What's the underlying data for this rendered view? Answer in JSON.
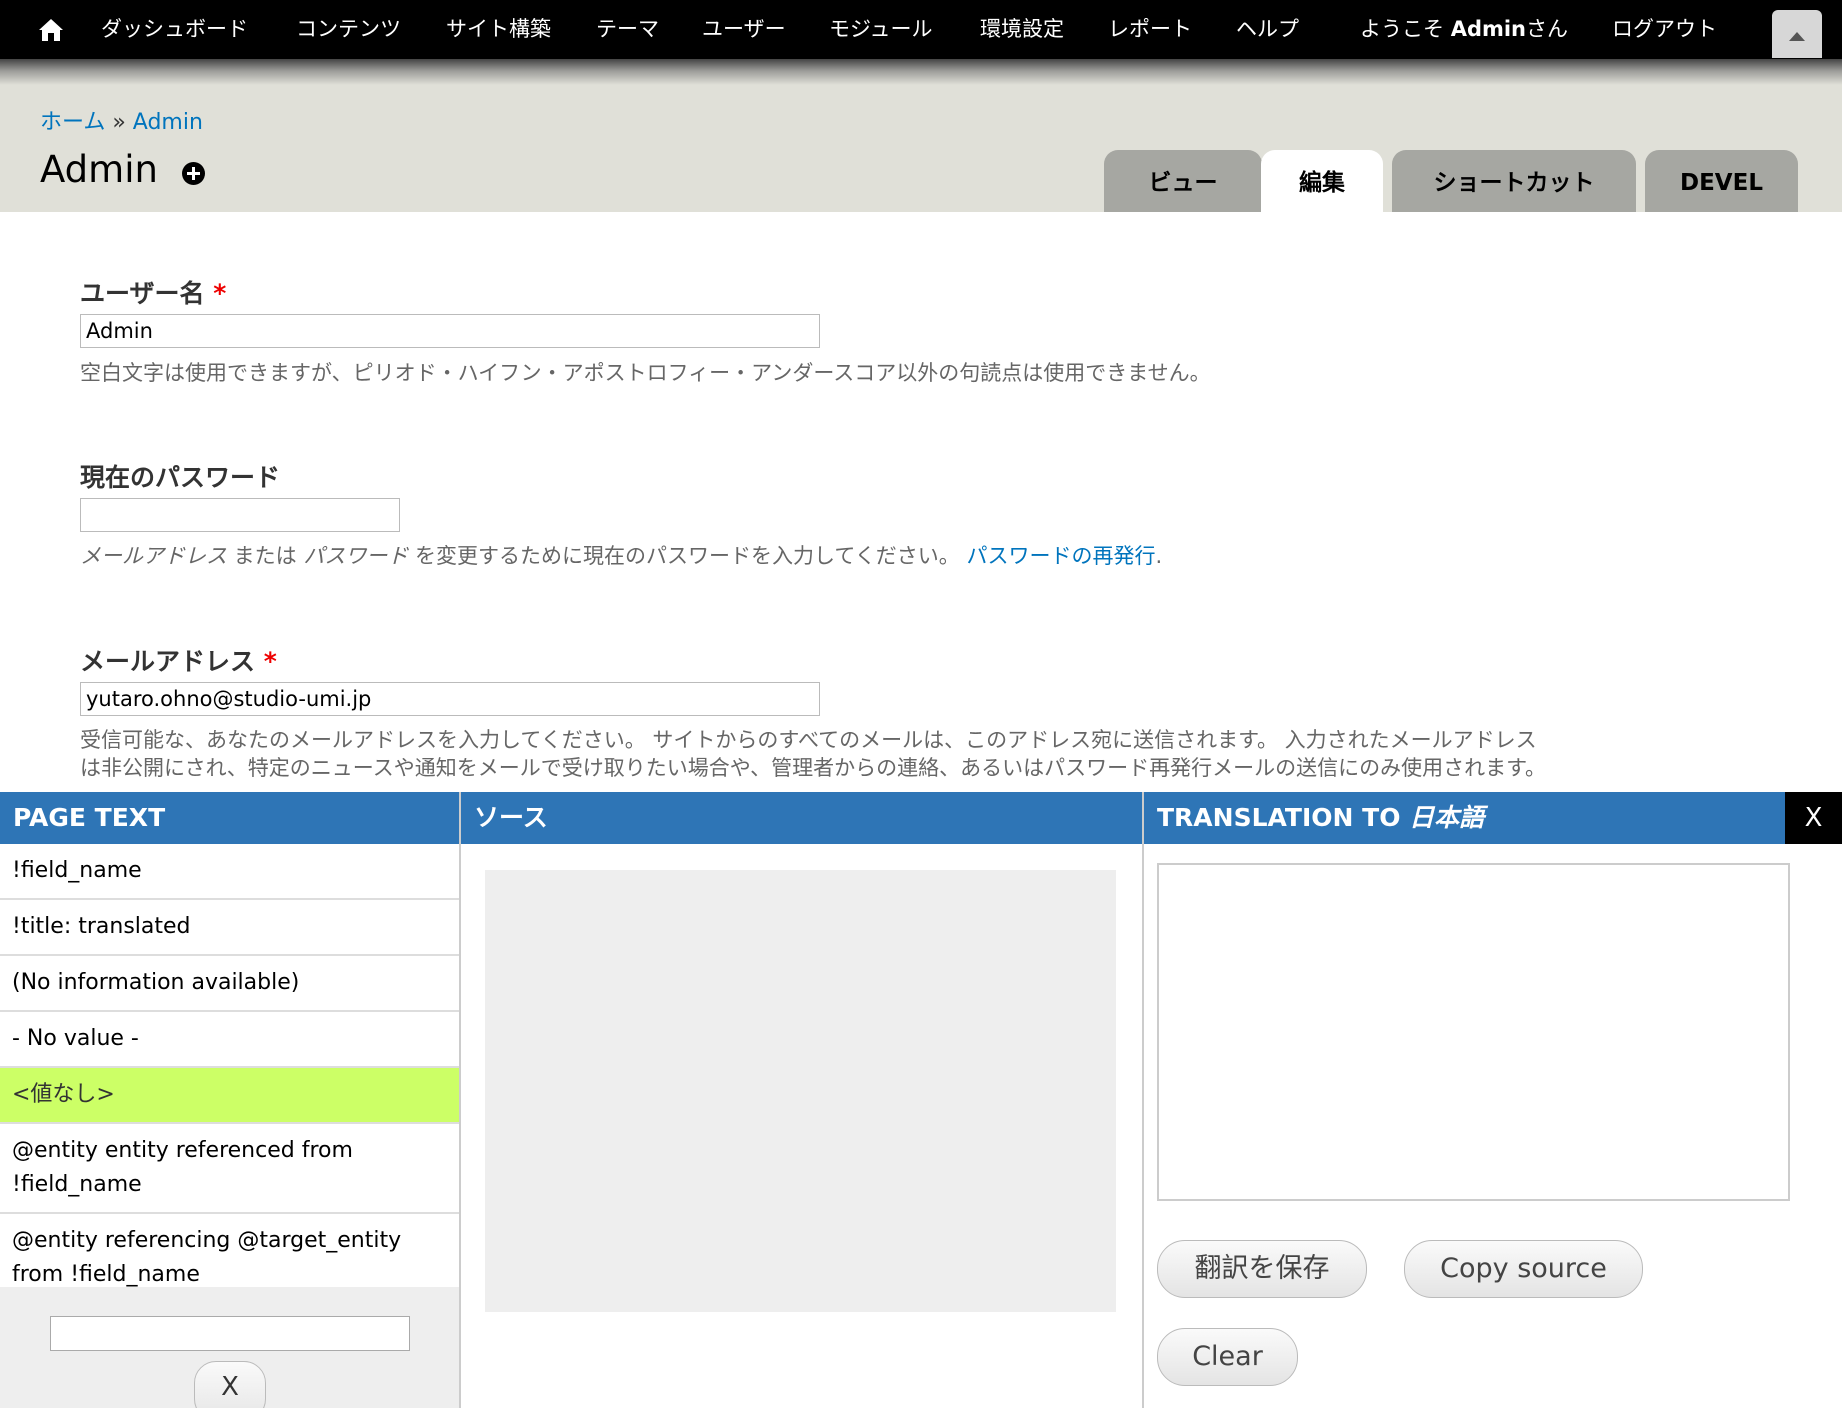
{
  "toolbar": {
    "items": [
      "ダッシュボード",
      "コンテンツ",
      "サイト構築",
      "テーマ",
      "ユーザー",
      "モジュール",
      "環境設定",
      "レポート",
      "ヘルプ"
    ],
    "welcome_prefix": "ようこそ ",
    "welcome_user": "Admin",
    "welcome_suffix": "さん",
    "logout": "ログアウト"
  },
  "breadcrumb": {
    "home": "ホーム",
    "sep": " » ",
    "current": "Admin"
  },
  "page_title": "Admin",
  "tabs": [
    "ビュー",
    "編集",
    "ショートカット",
    "DEVEL"
  ],
  "form": {
    "username": {
      "label": "ユーザー名",
      "required": "*",
      "value": "Admin",
      "description": "空白文字は使用できますが、ピリオド・ハイフン・アポストロフィー・アンダースコア以外の句読点は使用できません。"
    },
    "current_password": {
      "label": "現在のパスワード",
      "value": "",
      "desc_email": "メールアドレス",
      "desc_or": " または ",
      "desc_password": "パスワード",
      "desc_rest": " を変更するために現在のパスワードを入力してください。 ",
      "reset_link": "パスワードの再発行",
      "reset_dot": "."
    },
    "email": {
      "label": "メールアドレス",
      "required": "*",
      "value": "yutaro.ohno@studio-umi.jp",
      "description_line1": "受信可能な、あなたのメールアドレスを入力してください。 サイトからのすべてのメールは、このアドレス宛に送信されます。 入力されたメールアドレス",
      "description_line2": "は非公開にされ、特定のニュースや通知をメールで受け取りたい場合や、管理者からの連絡、あるいはパスワード再発行メールの送信にのみ使用されます。"
    }
  },
  "translation_panel": {
    "page_text_header": "PAGE TEXT",
    "source_header": "ソース",
    "translation_header_prefix": "TRANSLATION TO ",
    "translation_header_lang": "日本語",
    "close_label": "X",
    "strings": [
      "!field_name",
      "!title: translated",
      "(No information available)",
      "- No value -",
      "<値なし>",
      "@entity entity referenced from !field_name",
      "@entity referencing @target_entity from !field_name"
    ],
    "selected_index": 4,
    "filter_value": "",
    "filter_clear": "X",
    "source_text": "",
    "translation_text": "",
    "save_button": "翻訳を保存",
    "copy_button": "Copy source",
    "clear_button": "Clear"
  }
}
